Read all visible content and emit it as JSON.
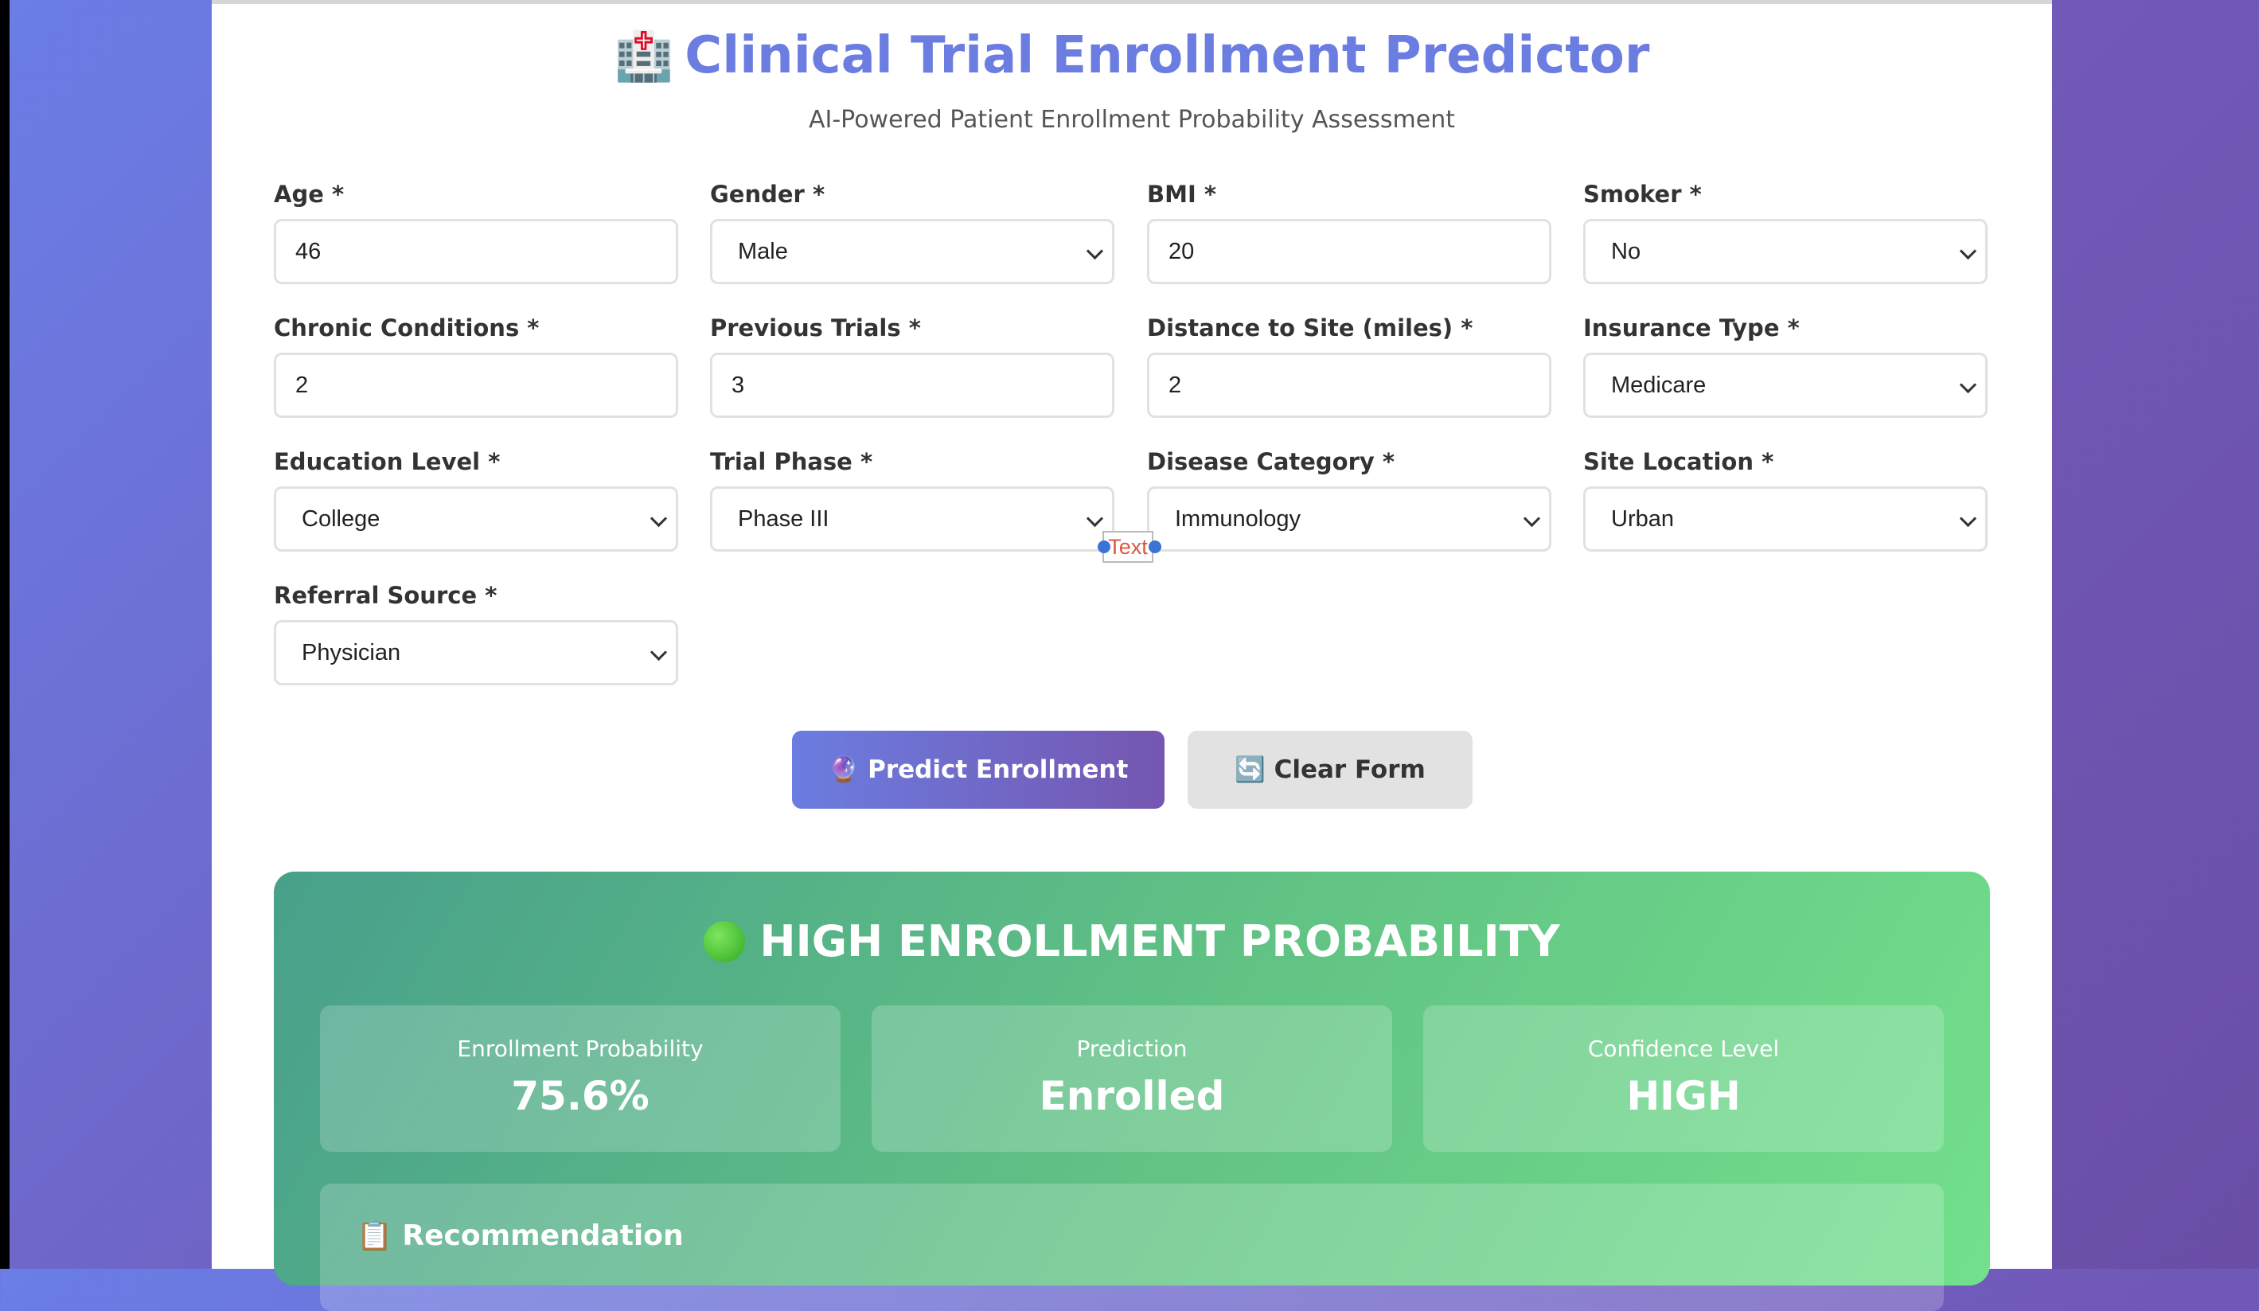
{
  "header": {
    "title_icon": "🏥",
    "title": "Clinical Trial Enrollment Predictor",
    "subtitle": "AI-Powered Patient Enrollment Probability Assessment"
  },
  "form": {
    "age": {
      "label": "Age *",
      "value": "46"
    },
    "gender": {
      "label": "Gender *",
      "value": "Male"
    },
    "bmi": {
      "label": "BMI *",
      "value": "20"
    },
    "smoker": {
      "label": "Smoker *",
      "value": "No"
    },
    "chronic_conditions": {
      "label": "Chronic Conditions *",
      "value": "2"
    },
    "previous_trials": {
      "label": "Previous Trials *",
      "value": "3"
    },
    "distance": {
      "label": "Distance to Site (miles) *",
      "value": "2"
    },
    "insurance": {
      "label": "Insurance Type *",
      "value": "Medicare"
    },
    "education": {
      "label": "Education Level *",
      "value": "College"
    },
    "trial_phase": {
      "label": "Trial Phase *",
      "value": "Phase III"
    },
    "disease_category": {
      "label": "Disease Category *",
      "value": "Immunology"
    },
    "site_location": {
      "label": "Site Location *",
      "value": "Urban"
    },
    "referral_source": {
      "label": "Referral Source *",
      "value": "Physician"
    }
  },
  "text_tag": "Text",
  "buttons": {
    "predict": "🔮 Predict Enrollment",
    "clear": "🔄 Clear Form"
  },
  "result": {
    "title": "HIGH ENROLLMENT PROBABILITY",
    "status_color": "#2eaa22",
    "stats": [
      {
        "label": "Enrollment Probability",
        "value": "75.6%"
      },
      {
        "label": "Prediction",
        "value": "Enrolled"
      },
      {
        "label": "Confidence Level",
        "value": "HIGH"
      }
    ],
    "recommendation_title": "📋 Recommendation"
  }
}
